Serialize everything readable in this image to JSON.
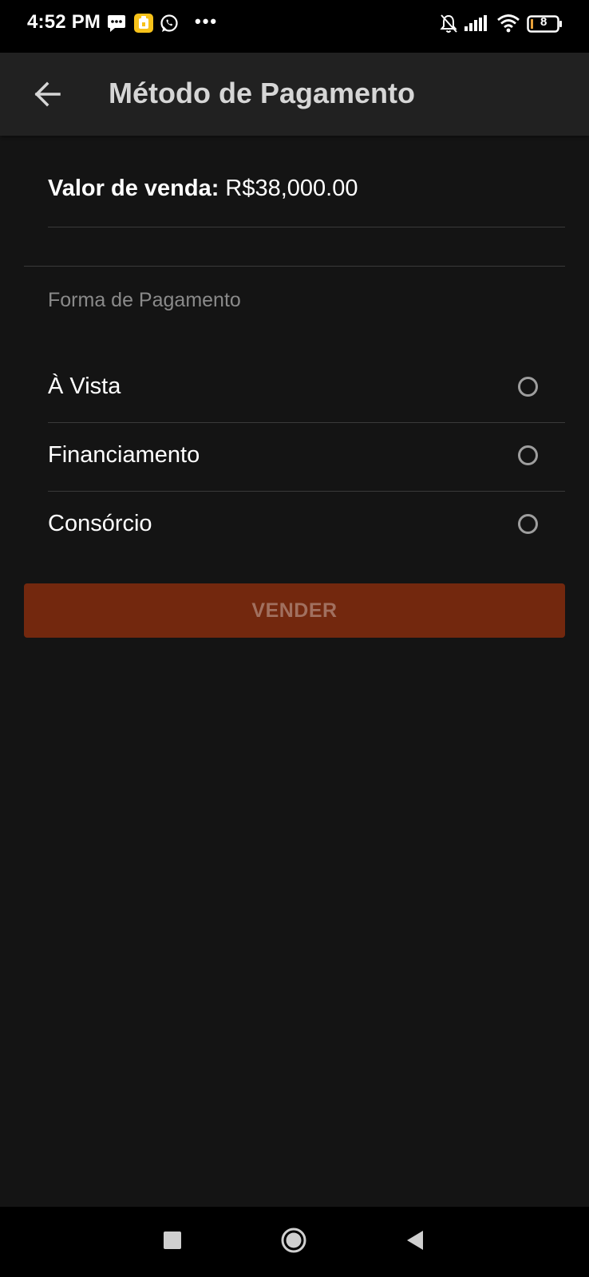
{
  "status_bar": {
    "time": "4:52 PM",
    "more": "•••",
    "battery_level": "8",
    "icons": [
      "message-icon",
      "app-notification-icon",
      "whatsapp-icon",
      "more-icon",
      "bell-off-icon",
      "signal-icon",
      "wifi-icon",
      "battery-icon"
    ]
  },
  "app_bar": {
    "title": "Método de Pagamento",
    "back_icon": "arrow-back-icon"
  },
  "sale": {
    "label": "Valor de venda:",
    "value": " R$38,000.00"
  },
  "payment": {
    "section_label": "Forma de Pagamento",
    "options": [
      {
        "label": "À Vista",
        "selected": false
      },
      {
        "label": "Financiamento",
        "selected": false
      },
      {
        "label": "Consórcio",
        "selected": false
      }
    ]
  },
  "actions": {
    "sell_label": "VENDER",
    "sell_enabled": false
  },
  "colors": {
    "background": "#141414",
    "app_bar": "#212121",
    "accent_button": "#73280e",
    "button_text_disabled": "#a1705f"
  },
  "nav_bar": {
    "icons": [
      "recents-icon",
      "home-icon",
      "back-icon"
    ]
  }
}
